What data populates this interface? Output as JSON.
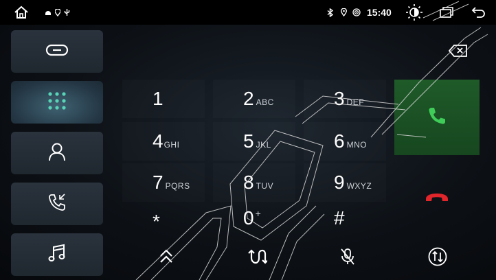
{
  "status_bar": {
    "left_icons": [
      "home-icon",
      "android-icon",
      "location-icon",
      "usb-icon"
    ],
    "right_icons": [
      "bluetooth-icon",
      "location-icon",
      "wifi-icon"
    ],
    "time": "15:40",
    "controls": [
      "brightness-icon",
      "recent-apps-icon",
      "back-icon"
    ]
  },
  "sidebar": {
    "items": [
      {
        "name": "link",
        "icon": "link-icon",
        "active": false
      },
      {
        "name": "dialpad",
        "icon": "dialpad-icon",
        "active": true
      },
      {
        "name": "contacts",
        "icon": "contacts-icon",
        "active": false
      },
      {
        "name": "call-log",
        "icon": "call-log-icon",
        "active": false
      },
      {
        "name": "music",
        "icon": "music-icon",
        "active": false
      }
    ]
  },
  "dialer": {
    "number": "",
    "keys": [
      {
        "digit": "1",
        "letters": ""
      },
      {
        "digit": "2",
        "letters": "ABC"
      },
      {
        "digit": "3",
        "letters": "DEF"
      },
      {
        "digit": "4",
        "letters": "GHI"
      },
      {
        "digit": "5",
        "letters": "JKL"
      },
      {
        "digit": "6",
        "letters": "MNO"
      },
      {
        "digit": "7",
        "letters": "PQRS"
      },
      {
        "digit": "8",
        "letters": "TUV"
      },
      {
        "digit": "9",
        "letters": "WXYZ"
      },
      {
        "digit": "*",
        "letters": ""
      },
      {
        "digit": "0",
        "letters": "+"
      },
      {
        "digit": "#",
        "letters": ""
      }
    ],
    "call_icon": "phone-call-icon",
    "end_icon": "phone-hangup-icon",
    "backspace_icon": "backspace-icon"
  },
  "bottom_bar": {
    "icons": [
      "collapse-keypad-icon",
      "merge-calls-icon",
      "mute-mic-icon",
      "switch-audio-icon"
    ]
  },
  "colors": {
    "accent": "#58d4b8",
    "call_green": "#1f5a29",
    "call_icon": "#3fcc58",
    "end_red": "#e0252b"
  }
}
